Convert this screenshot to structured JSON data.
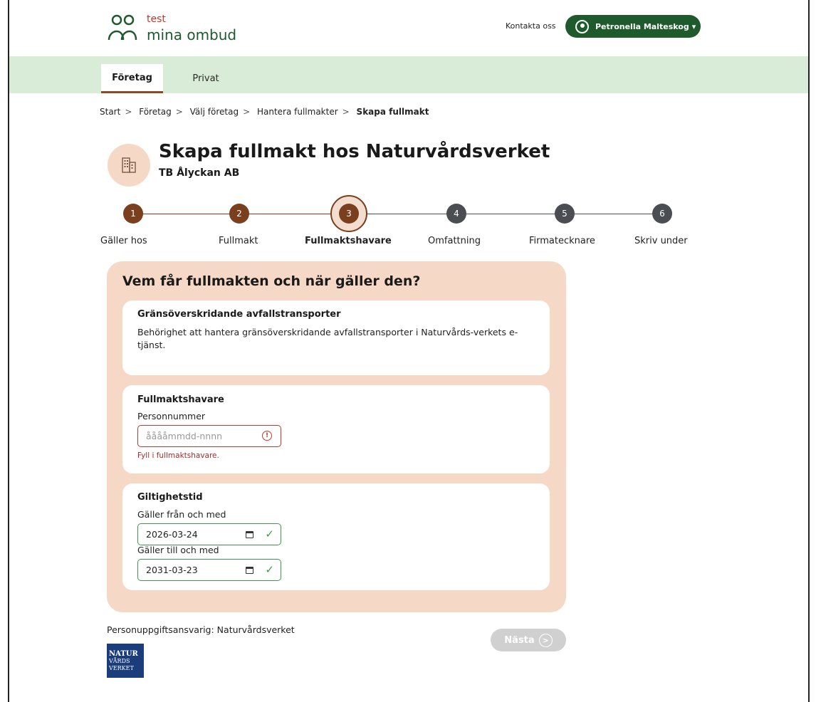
{
  "header": {
    "logo_test": "test",
    "logo_name": "mina ombud",
    "contact_label": "Kontakta oss",
    "user_name": "Petronella Malteskog",
    "user_caret": "▾"
  },
  "nav": {
    "tabs": [
      {
        "label": "Företag",
        "active": true
      },
      {
        "label": "Privat",
        "active": false
      }
    ]
  },
  "breadcrumb": [
    "Start",
    "Företag",
    "Välj företag",
    "Hantera fullmakter",
    "Skapa fullmakt"
  ],
  "breadcrumb_sep": ">",
  "page": {
    "title": "Skapa fullmakt hos Naturvårdsverket",
    "company": "TB Ålyckan AB"
  },
  "steps": [
    {
      "num": "1",
      "label": "Gäller hos",
      "state": "done"
    },
    {
      "num": "2",
      "label": "Fullmakt",
      "state": "done"
    },
    {
      "num": "3",
      "label": "Fullmaktshavare",
      "state": "active"
    },
    {
      "num": "4",
      "label": "Omfattning",
      "state": "todo"
    },
    {
      "num": "5",
      "label": "Firmatecknare",
      "state": "todo"
    },
    {
      "num": "6",
      "label": "Skriv under",
      "state": "todo"
    }
  ],
  "form": {
    "heading": "Vem får fullmakten och när gäller den?",
    "scope": {
      "title": "Gränsöverskridande avfallstransporter",
      "text": "Behörighet att hantera gränsöverskridande avfallstransporter i Naturvårds-verkets e-tjänst."
    },
    "holder": {
      "title": "Fullmaktshavare",
      "field_label": "Personnummer",
      "placeholder": "ååååmmdd-nnnn",
      "error": "Fyll i fullmaktshavare."
    },
    "validity": {
      "title": "Giltighetstid",
      "from_label": "Gäller från och med",
      "from_value": "2026-03-24",
      "to_label": "Gäller till och med",
      "to_value": "2031-03-23"
    }
  },
  "footer": {
    "controller_text": "Personuppgiftsansvarig: Naturvårdsverket",
    "logo_line1": "NATUR",
    "logo_line2": "VÅRDS",
    "logo_line3": "VERKET",
    "next_label": "Nästa"
  },
  "colors": {
    "brand_green": "#1e5a2c",
    "nav_bg": "#d9ecd7",
    "step_done": "#7a3f1d",
    "step_todo": "#4a4d52",
    "panel_bg": "#f5d9c6",
    "error": "#c0392b",
    "ok": "#3a9b4a"
  }
}
